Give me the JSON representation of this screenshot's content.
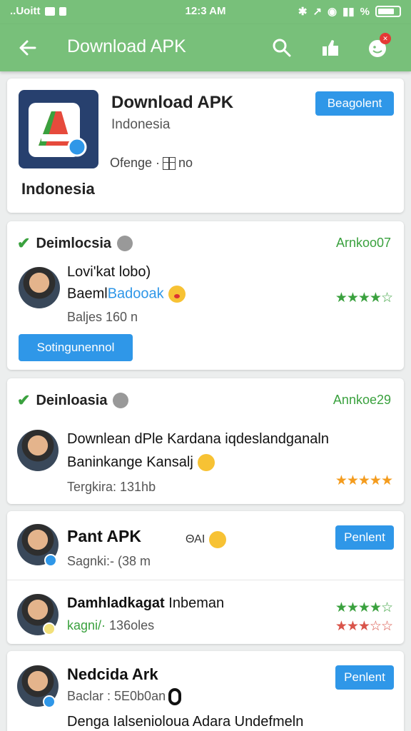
{
  "status_bar": {
    "carrier": "..Uoitt",
    "time": "12:3 AM",
    "battery_label": "%"
  },
  "app_bar": {
    "title": "Download APK"
  },
  "app_card": {
    "name": "Download APK",
    "region": "Indonesia",
    "meta": "Ofenge ·",
    "meta_suffix": "no",
    "footer": "Indonesia",
    "button": "Beagolent"
  },
  "section1": {
    "title": "Deimlocsia",
    "count": "Arnkoo07",
    "line1": "Lovi'kat lobo)",
    "line2_prefix": "Baeml",
    "line2_link": "Badooak",
    "line3": "Baljes 160 n",
    "button": "Sotingunennol",
    "rating": 4
  },
  "section2": {
    "title": "Deinloasia",
    "count": "Annkoe29",
    "line1": "Downlean dPle Kardana iqdeslandganaln",
    "line2": "Baninkange Kansalj",
    "line3": "Tergkira: 131hb",
    "rating": 5
  },
  "item1": {
    "title": "Pant APK",
    "tag": "ΘΑΙ",
    "sub": "Sagnki:- (38 m",
    "button": "Penlent"
  },
  "item2": {
    "title_bold": "Damhladkagat",
    "title_rest": "Inbeman",
    "sub_green": "kagni/·",
    "sub_rest": "136oles",
    "rating_green": 4,
    "rating_red": 3
  },
  "item3": {
    "title": "Nedcida Ark",
    "sub": "Baclar : 5E0b0an",
    "line": "Denga Ialsenioloua Adara Undefmeln",
    "button": "Penlent"
  },
  "colors": {
    "app_bar": "#78c07a",
    "accent_blue": "#2f97e8",
    "accent_green": "#3aa13e",
    "star_orange": "#f49c1e"
  }
}
